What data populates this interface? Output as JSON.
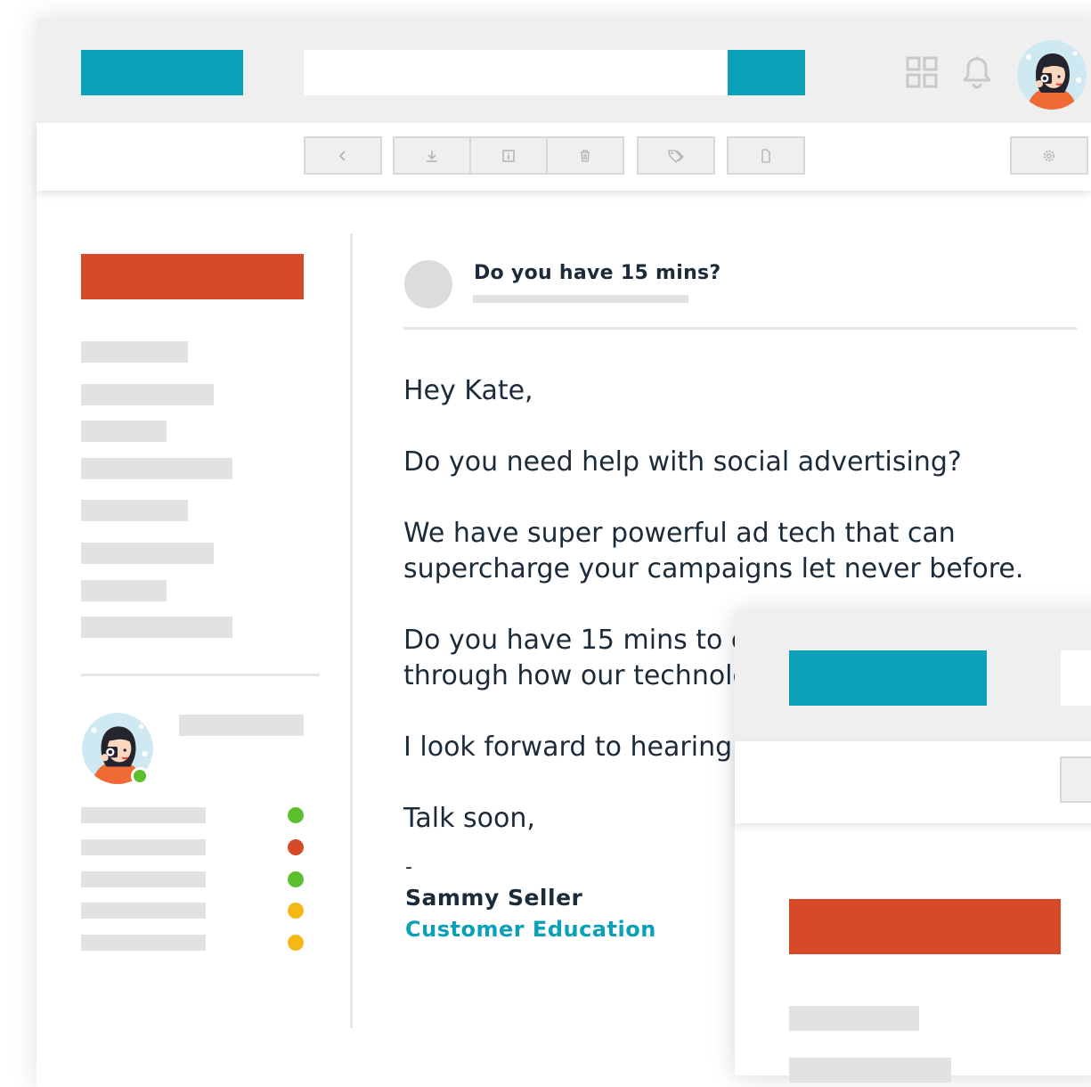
{
  "colors": {
    "teal": "#0aa0b8",
    "orange": "#d64a2a",
    "gray": "#e2e2e2",
    "green": "#5cc02e",
    "red": "#d64a2a",
    "yellow": "#f4b917"
  },
  "toolbar": {
    "icons": [
      "back-icon",
      "download-icon",
      "info-icon",
      "trash-icon",
      "tag-icon",
      "document-icon",
      "settings-icon"
    ]
  },
  "email": {
    "subject": "Do you have 15 mins?",
    "greeting": "Hey Kate,",
    "line1": "Do you need help with social advertising?",
    "line2a": "We have super powerful ad tech that can",
    "line2b": "supercharge your campaigns let never before.",
    "line3a": "Do you have 15 mins to c",
    "line3b": "through how our technolo",
    "line4": "I look forward to hearing",
    "closing": "Talk soon,",
    "dash": "-",
    "sender_name": "Sammy Seller",
    "sender_title": "Customer Education"
  },
  "contacts": {
    "statuses": [
      "green",
      "red",
      "green",
      "yellow",
      "yellow"
    ]
  }
}
